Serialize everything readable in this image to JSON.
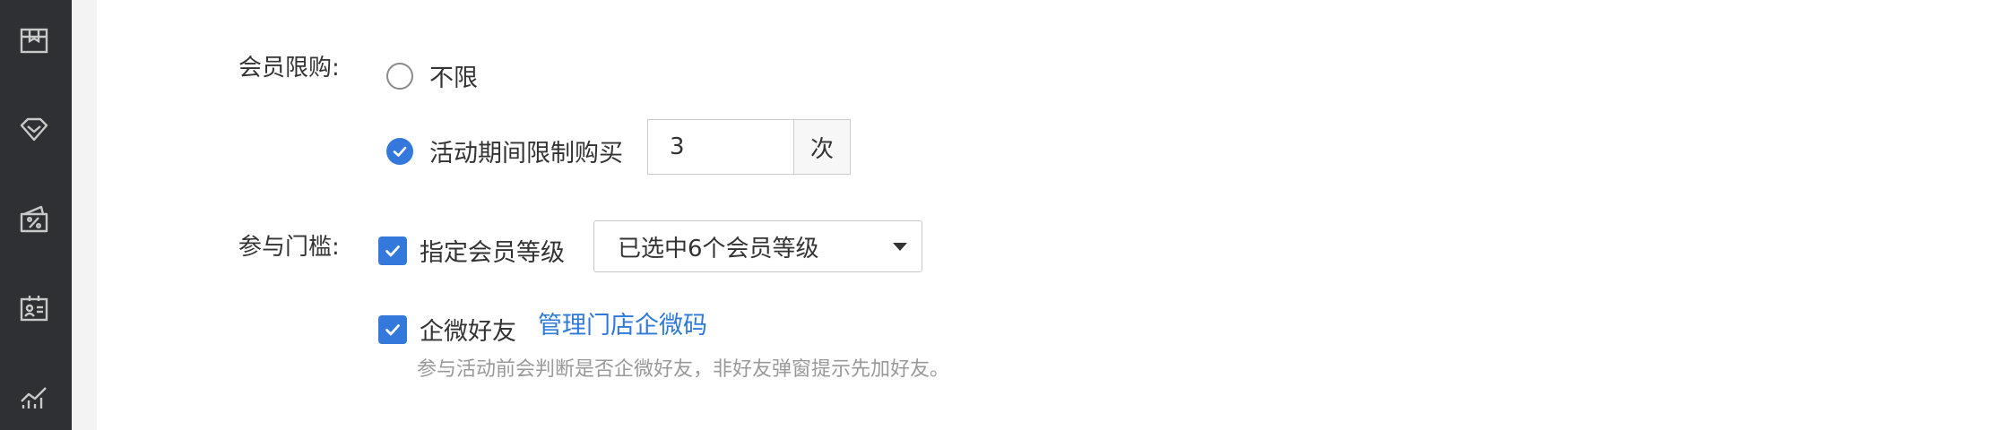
{
  "sidebar": {
    "icons": [
      "package-icon",
      "diamond-icon",
      "coupon-icon",
      "member-card-icon",
      "analytics-icon"
    ]
  },
  "member_limit": {
    "label": "会员限购:",
    "options": [
      {
        "label": "不限",
        "selected": false
      },
      {
        "label": "活动期间限制购买",
        "selected": true
      }
    ],
    "limit_value": "3",
    "limit_unit": "次"
  },
  "threshold": {
    "label": "参与门槛:",
    "level_checkbox": {
      "label": "指定会员等级",
      "checked": true
    },
    "level_select_value": "已选中6个会员等级",
    "wecom_checkbox": {
      "label": "企微好友",
      "checked": true
    },
    "manage_link": "管理门店企微码",
    "hint": "参与活动前会判断是否企微好友，非好友弹窗提示先加好友。"
  },
  "colors": {
    "accent": "#3478db",
    "link": "#2f7ad8",
    "sidebar": "#2e3033"
  }
}
